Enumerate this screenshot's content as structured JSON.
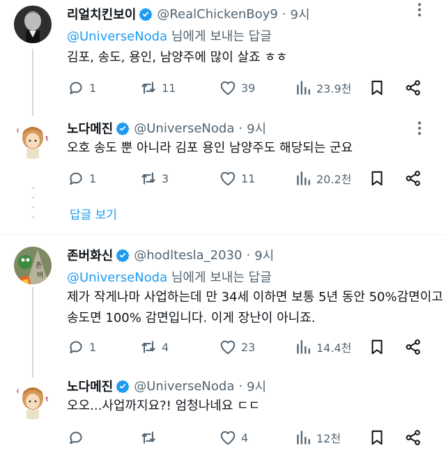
{
  "colors": {
    "accent": "#1d9bf0",
    "muted": "#536471",
    "text": "#0f1419"
  },
  "tweets": [
    {
      "name": "리얼치킨보이",
      "handle": "@RealChickenBoy9",
      "separator": "·",
      "time": "9시",
      "reply_to": {
        "mention": "@UniverseNoda",
        "suffix": " 님에게 보내는 답글"
      },
      "lines": [
        "김포, 송도, 용인, 남양주에 많이 살죠 ㅎㅎ"
      ],
      "stats": {
        "replies": "1",
        "retweets": "11",
        "likes": "39",
        "views": "23.9천"
      }
    },
    {
      "name": "노다메진",
      "handle": "@UniverseNoda",
      "separator": "·",
      "time": "9시",
      "lines": [
        "오호 송도 뿐 아니라 김포 용인 남양주도 해당되는 군요"
      ],
      "stats": {
        "replies": "1",
        "retweets": "3",
        "likes": "11",
        "views": "20.2천"
      }
    },
    {
      "name": "존버화신",
      "handle": "@hodltesla_2030",
      "separator": "·",
      "time": "9시",
      "reply_to": {
        "mention": "@UniverseNoda",
        "suffix": " 님에게 보내는 답글"
      },
      "lines": [
        "제가 작게나마 사업하는데 만 34세 이하면 보통 5년 동안 50%감면이고",
        "송도면 100% 감면입니다. 이게 장난이 아니죠."
      ],
      "stats": {
        "replies": "1",
        "retweets": "4",
        "likes": "23",
        "views": "14.4천"
      }
    },
    {
      "name": "노다메진",
      "handle": "@UniverseNoda",
      "separator": "·",
      "time": "9시",
      "lines": [
        "오오...사업까지요?! 엄청나네요 ㄷㄷ"
      ],
      "stats": {
        "replies": "",
        "retweets": "",
        "likes": "4",
        "views": "12천"
      }
    }
  ],
  "show_replies_label": "답글 보기"
}
